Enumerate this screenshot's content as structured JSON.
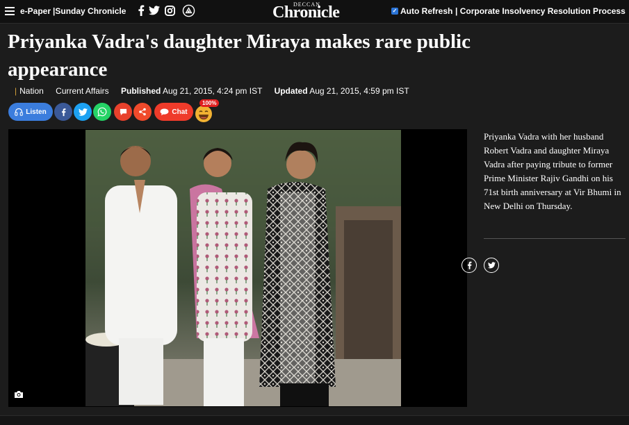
{
  "topbar": {
    "epaper_label": "e-Paper",
    "sunday_label": "|Sunday Chronicle",
    "logo_small": "DECCAN",
    "logo_main": "Chronicle",
    "auto_refresh_label": "Auto Refresh",
    "corporate_link": "| Corporate Insolvency Resolution Process",
    "auto_refresh_checked": true
  },
  "article": {
    "headline": "Priyanka Vadra's daughter Miraya makes rare public appearance",
    "category_sep": "|",
    "category": "Nation",
    "subcategory": "Current Affairs",
    "published_label": "Published",
    "published_date": "Aug 21, 2015, 4:24 pm IST",
    "updated_label": "Updated",
    "updated_date": "Aug 21, 2015, 4:59 pm IST"
  },
  "share": {
    "listen_label": "Listen",
    "chat_label": "Chat",
    "reaction_badge": "100%"
  },
  "caption": {
    "text": "Priyanka Vadra with her husband Robert Vadra and daughter Miraya Vadra after paying tribute to former Prime Minister Rajiv Gandhi on his 71st birth anniversary at Vir Bhumi in New Delhi on Thursday."
  },
  "colors": {
    "listen": "#3b7ddd",
    "facebook": "#3b5998",
    "twitter": "#1da1f2",
    "whatsapp": "#25d366",
    "comment": "#e8412c",
    "share": "#f04a2b",
    "chat": "#ef3b2a",
    "background": "#1c1c1c"
  },
  "icons": [
    "hamburger-icon",
    "facebook-icon",
    "twitter-icon",
    "instagram-icon",
    "koo-icon",
    "headphones-icon",
    "whatsapp-icon",
    "comment-icon",
    "share-icon",
    "chat-icon",
    "laugh-emoji-icon",
    "camera-icon"
  ]
}
